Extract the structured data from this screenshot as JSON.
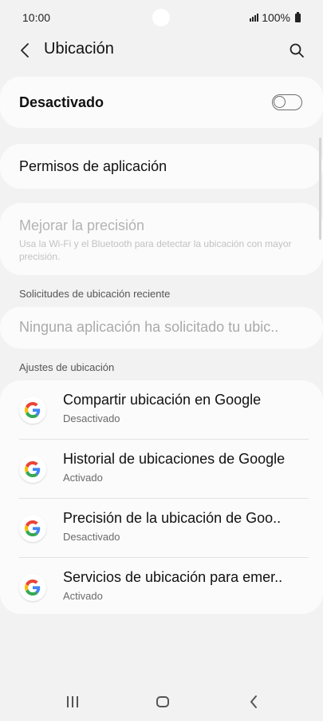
{
  "status_bar": {
    "time": "10:00",
    "battery": "100%"
  },
  "header": {
    "title": "Ubicación",
    "back_icon": "chevron-left-icon",
    "search_icon": "search-icon"
  },
  "location_toggle": {
    "label": "Desactivado",
    "state": "off"
  },
  "permissions": {
    "label": "Permisos de aplicación"
  },
  "precision": {
    "title": "Mejorar la precisión",
    "description": "Usa la Wi-Fi y el Bluetooth para detectar la ubicación con mayor precisión."
  },
  "recent_requests": {
    "header": "Solicitudes de ubicación reciente",
    "empty_text": "Ninguna aplicación ha solicitado tu ubic.."
  },
  "location_settings": {
    "header": "Ajustes de ubicación",
    "items": [
      {
        "title": "Compartir ubicación en Google",
        "subtitle": "Desactivado",
        "icon": "google-icon"
      },
      {
        "title": "Historial de ubicaciones de Google",
        "subtitle": "Activado",
        "icon": "google-icon"
      },
      {
        "title": "Precisión de la ubicación de Goo..",
        "subtitle": "Desactivado",
        "icon": "google-icon"
      },
      {
        "title": "Servicios de ubicación para emer..",
        "subtitle": "Activado",
        "icon": "google-icon"
      }
    ]
  },
  "colors": {
    "background": "#f2f2f2",
    "card": "#fbfbfb",
    "disabled_text": "#b3b3b3",
    "google_blue": "#4285F4",
    "google_red": "#EA4335",
    "google_yellow": "#FBBC05",
    "google_green": "#34A853"
  }
}
